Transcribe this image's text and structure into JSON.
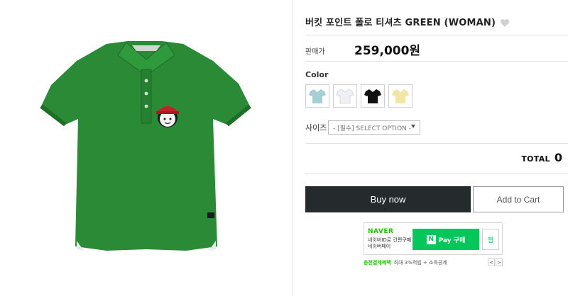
{
  "product": {
    "title": "버킷 포인트 폴로 티셔츠 GREEN (WOMAN)",
    "price_label": "판매가",
    "price": "259,000원",
    "image_alt": "green polo shirt",
    "shirt_color": "#2a8a35"
  },
  "colors": {
    "label": "Color",
    "swatches": [
      {
        "name": "mint",
        "hex": "#a6cfd5"
      },
      {
        "name": "white",
        "hex": "#f4f6fa"
      },
      {
        "name": "black",
        "hex": "#111111"
      },
      {
        "name": "yellow",
        "hex": "#f2e6a6"
      }
    ]
  },
  "size": {
    "label": "사이즈",
    "select_value": "- [필수] SELECT OPTION -"
  },
  "total": {
    "label": "TOTAL",
    "value": "0"
  },
  "actions": {
    "buy_now": "Buy now",
    "add_to_cart": "Add to Cart"
  },
  "npay": {
    "brand": "NAVER",
    "desc": "네이버ID로 간편구매 네이버페이",
    "button_label": "Pay 구매",
    "wish_label": "찜",
    "benefit_strong": "충전결제혜택",
    "benefit_text": "최대 3%적립 + 소득공제",
    "nav_prev": "<",
    "nav_next": ">"
  }
}
